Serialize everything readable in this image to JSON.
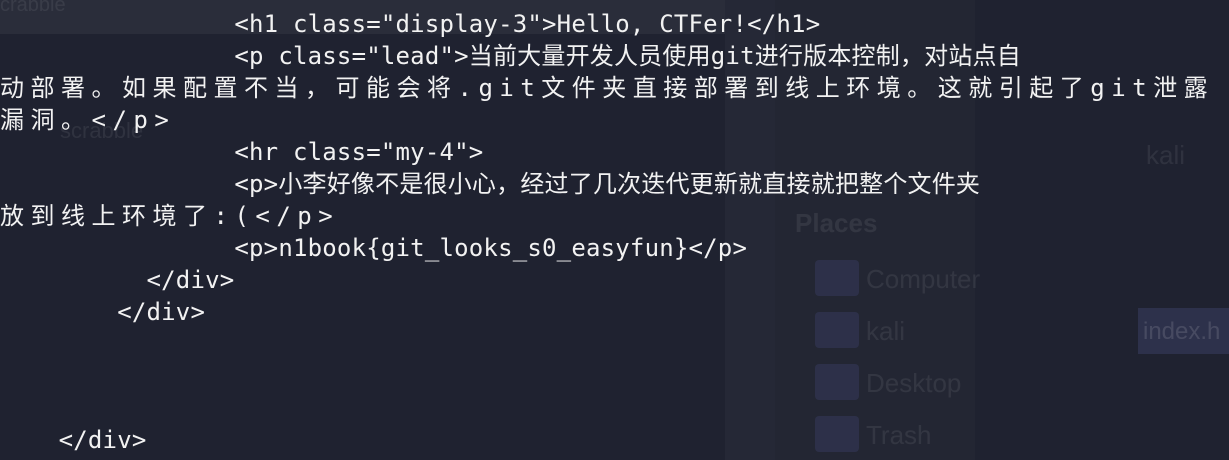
{
  "background": {
    "ghost_labels": [
      "crabble",
      "scrabble",
      "Places",
      "Computer",
      "kali",
      "Desktop",
      "Trash",
      "kali",
      "index.h"
    ]
  },
  "terminal": {
    "lines": [
      "                <h1 class=\"display-3\">Hello, CTFer!</h1>",
      "                <p class=\"lead\">当前大量开发人员使用git进行版本控制，对站点自",
      "动部署。如果配置不当，可能会将.git文件夹直接部署到线上环境。这就引起了git泄露",
      "漏洞。</p>",
      "                <hr class=\"my-4\">",
      "                <p>小李好像不是很小心，经过了几次迭代更新就直接就把整个文件夹",
      "放到线上环境了:(</p>",
      "                <p>n1book{git_looks_s0_easyfun}</p>",
      "          </div>",
      "        </div>",
      "",
      "",
      "",
      "    </div>"
    ]
  },
  "colors": {
    "background": "#1f2230",
    "text": "#f2f2f2"
  }
}
